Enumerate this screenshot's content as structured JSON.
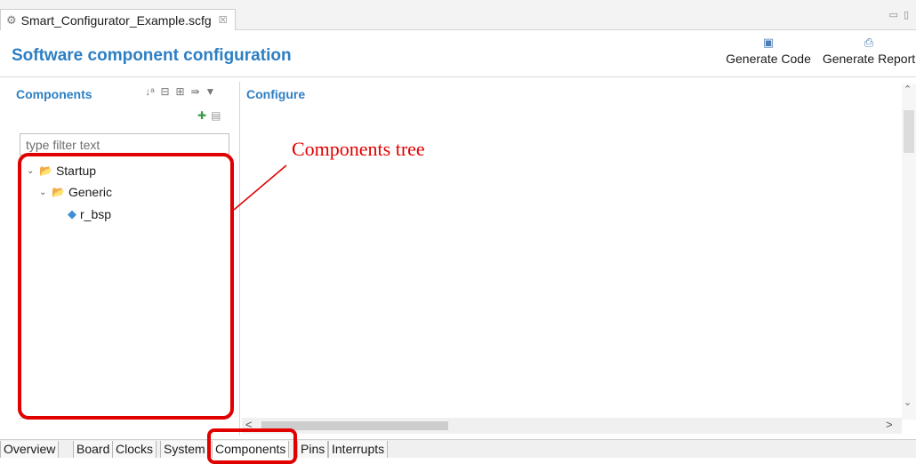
{
  "editor": {
    "tab_title": "Smart_Configurator_Example.scfg",
    "tab_close": "☒"
  },
  "header": {
    "title": "Software component configuration",
    "generate_code_label": "Generate Code",
    "generate_report_label": "Generate Report"
  },
  "components_pane": {
    "title": "Components",
    "filter_placeholder": "type filter text",
    "tree": [
      {
        "label": "Startup",
        "level": 0,
        "expanded": true
      },
      {
        "label": "Generic",
        "level": 1,
        "expanded": true
      },
      {
        "label": "r_bsp",
        "level": 2
      }
    ]
  },
  "configure_pane": {
    "title": "Configure"
  },
  "page_tabs": [
    "Overview",
    "Board",
    "Clocks",
    "System",
    "Components",
    "Pins",
    "Interrupts"
  ],
  "active_page_tab": "Components",
  "annotation": {
    "label": "Components tree",
    "color": "#e00000"
  },
  "colors": {
    "accent": "#2d7fc3",
    "highlight": "#e00000"
  }
}
